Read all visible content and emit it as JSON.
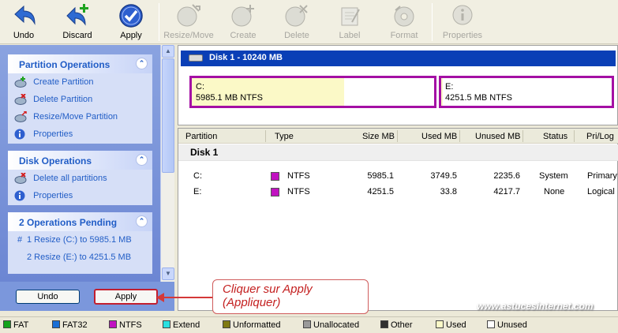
{
  "toolbar": {
    "undo": "Undo",
    "discard": "Discard",
    "apply": "Apply",
    "resize_move": "Resize/Move",
    "create": "Create",
    "delete": "Delete",
    "label": "Label",
    "format": "Format",
    "properties": "Properties"
  },
  "tasks": {
    "partition_ops": {
      "title": "Partition Operations",
      "items": [
        "Create Partition",
        "Delete Partition",
        "Resize/Move Partition",
        "Properties"
      ]
    },
    "disk_ops": {
      "title": "Disk Operations",
      "items": [
        "Delete all partitions",
        "Properties"
      ]
    },
    "pending": {
      "title": "2 Operations Pending",
      "items": [
        {
          "marker": "#",
          "text": "1  Resize (C:) to 5985.1 MB"
        },
        {
          "marker": "",
          "text": "2  Resize (E:) to 4251.5 MB"
        }
      ]
    },
    "undo_button": "Undo",
    "apply_button": "Apply"
  },
  "disk_map": {
    "title": "Disk 1 - 10240 MB",
    "partitions": [
      {
        "letter": "C:",
        "info": "5985.1 MB  NTFS",
        "used_fraction": 0.63
      },
      {
        "letter": "E:",
        "info": "4251.5 MB  NTFS",
        "used_fraction": 0.01
      }
    ]
  },
  "list": {
    "columns": [
      "Partition",
      "Type",
      "Size MB",
      "Used MB",
      "Unused MB",
      "Status",
      "Pri/Log"
    ],
    "disk_label": "Disk 1",
    "rows": [
      {
        "partition": "C:",
        "type": "NTFS",
        "size": "5985.1",
        "used": "3749.5",
        "unused": "2235.6",
        "status": "System",
        "prilog": "Primary"
      },
      {
        "partition": "E:",
        "type": "NTFS",
        "size": "4251.5",
        "used": "33.8",
        "unused": "4217.7",
        "status": "None",
        "prilog": "Logical"
      }
    ]
  },
  "annotation": {
    "line1": "Cliquer sur Apply",
    "line2": "(Appliquer)"
  },
  "watermark": "www.astucesinternet.com",
  "legend": [
    {
      "label": "FAT",
      "color": "#14a31c"
    },
    {
      "label": "FAT32",
      "color": "#1a6fd6"
    },
    {
      "label": "NTFS",
      "color": "#c112c1"
    },
    {
      "label": "Extend",
      "color": "#2ae0e0"
    },
    {
      "label": "Unformatted",
      "color": "#7f7a12"
    },
    {
      "label": "Unallocated",
      "color": "#9a9a9a"
    },
    {
      "label": "Other",
      "color": "#303030"
    },
    {
      "label": "Used",
      "color": "#fbf9c7"
    },
    {
      "label": "Unused",
      "color": "#ffffff"
    }
  ],
  "colors": {
    "ntfs_border": "#a40fa4",
    "disk_header": "#0a3fb6",
    "task_link": "#215dc6",
    "callout_text": "#c42020"
  }
}
